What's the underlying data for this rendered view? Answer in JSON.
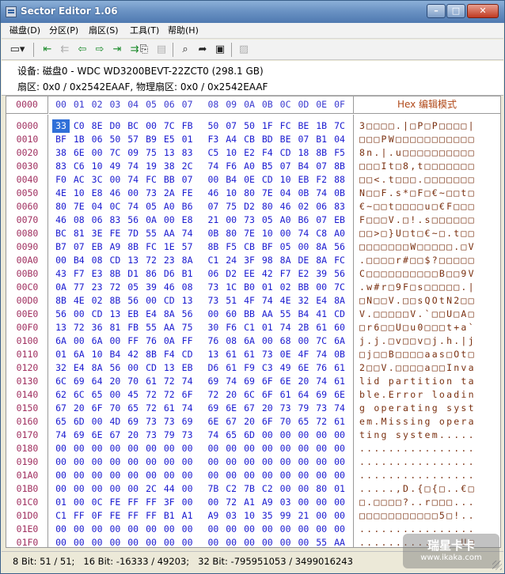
{
  "window": {
    "title": "Sector Editor 1.06"
  },
  "menu": [
    {
      "label": "磁盘(D)"
    },
    {
      "label": "分区(P)"
    },
    {
      "label": "扇区(S)"
    },
    {
      "label": "工具(T)"
    },
    {
      "label": "帮助(H)"
    }
  ],
  "toolbar_icons": [
    "disk-icon",
    "first-sector-icon",
    "prev-partition-icon",
    "prev-sector-icon",
    "next-sector-icon",
    "next-partition-icon",
    "last-sector-icon",
    "copy-icon",
    "paste-icon",
    "find-icon",
    "goto-icon",
    "export-icon",
    "save-icon"
  ],
  "info": {
    "device": "设备: 磁盘0 - WDC WD3200BEVT-22ZCT0 (298.1 GB)",
    "sector": "扇区: 0x0 / 0x2542EAAF, 物理扇区: 0x0 / 0x2542EAAF"
  },
  "header": {
    "offset": "0000",
    "columns": [
      "00",
      "01",
      "02",
      "03",
      "04",
      "05",
      "06",
      "07",
      "08",
      "09",
      "0A",
      "0B",
      "0C",
      "0D",
      "0E",
      "0F"
    ],
    "ascii_title": "Hex 编辑模式"
  },
  "rows": [
    {
      "offset": "0000",
      "bytes": [
        "33",
        "C0",
        "8E",
        "D0",
        "BC",
        "00",
        "7C",
        "FB",
        "50",
        "07",
        "50",
        "1F",
        "FC",
        "BE",
        "1B",
        "7C"
      ],
      "ascii": "3□□□□.|□P□P□□□□|"
    },
    {
      "offset": "0010",
      "bytes": [
        "BF",
        "1B",
        "06",
        "50",
        "57",
        "B9",
        "E5",
        "01",
        "F3",
        "A4",
        "CB",
        "BD",
        "BE",
        "07",
        "B1",
        "04"
      ],
      "ascii": "□□□PW□□□□□□□□□□□"
    },
    {
      "offset": "0020",
      "bytes": [
        "38",
        "6E",
        "00",
        "7C",
        "09",
        "75",
        "13",
        "83",
        "C5",
        "10",
        "E2",
        "F4",
        "CD",
        "18",
        "8B",
        "F5"
      ],
      "ascii": "8n.|.u□□□□□□□□□□"
    },
    {
      "offset": "0030",
      "bytes": [
        "83",
        "C6",
        "10",
        "49",
        "74",
        "19",
        "38",
        "2C",
        "74",
        "F6",
        "A0",
        "B5",
        "07",
        "B4",
        "07",
        "8B"
      ],
      "ascii": "□□□It□8,t□□□□□□□"
    },
    {
      "offset": "0040",
      "bytes": [
        "F0",
        "AC",
        "3C",
        "00",
        "74",
        "FC",
        "BB",
        "07",
        "00",
        "B4",
        "0E",
        "CD",
        "10",
        "EB",
        "F2",
        "88"
      ],
      "ascii": "□□<.t□□□.□□□□□□□"
    },
    {
      "offset": "0050",
      "bytes": [
        "4E",
        "10",
        "E8",
        "46",
        "00",
        "73",
        "2A",
        "FE",
        "46",
        "10",
        "80",
        "7E",
        "04",
        "0B",
        "74",
        "0B"
      ],
      "ascii": "N□□F.s*□F□€~□□t□"
    },
    {
      "offset": "0060",
      "bytes": [
        "80",
        "7E",
        "04",
        "0C",
        "74",
        "05",
        "A0",
        "B6",
        "07",
        "75",
        "D2",
        "80",
        "46",
        "02",
        "06",
        "83"
      ],
      "ascii": "€~□□t□□□□u□€F□□□"
    },
    {
      "offset": "0070",
      "bytes": [
        "46",
        "08",
        "06",
        "83",
        "56",
        "0A",
        "00",
        "E8",
        "21",
        "00",
        "73",
        "05",
        "A0",
        "B6",
        "07",
        "EB"
      ],
      "ascii": "F□□□V.□!.s□□□□□□"
    },
    {
      "offset": "0080",
      "bytes": [
        "BC",
        "81",
        "3E",
        "FE",
        "7D",
        "55",
        "AA",
        "74",
        "0B",
        "80",
        "7E",
        "10",
        "00",
        "74",
        "C8",
        "A0"
      ],
      "ascii": "□□>□}U□t□€~□.t□□"
    },
    {
      "offset": "0090",
      "bytes": [
        "B7",
        "07",
        "EB",
        "A9",
        "8B",
        "FC",
        "1E",
        "57",
        "8B",
        "F5",
        "CB",
        "BF",
        "05",
        "00",
        "8A",
        "56"
      ],
      "ascii": "□□□□□□□W□□□□□.□V"
    },
    {
      "offset": "00A0",
      "bytes": [
        "00",
        "B4",
        "08",
        "CD",
        "13",
        "72",
        "23",
        "8A",
        "C1",
        "24",
        "3F",
        "98",
        "8A",
        "DE",
        "8A",
        "FC"
      ],
      "ascii": ".□□□□r#□□$?□□□□□"
    },
    {
      "offset": "00B0",
      "bytes": [
        "43",
        "F7",
        "E3",
        "8B",
        "D1",
        "86",
        "D6",
        "B1",
        "06",
        "D2",
        "EE",
        "42",
        "F7",
        "E2",
        "39",
        "56"
      ],
      "ascii": "C□□□□□□□□□□B□□9V"
    },
    {
      "offset": "00C0",
      "bytes": [
        "0A",
        "77",
        "23",
        "72",
        "05",
        "39",
        "46",
        "08",
        "73",
        "1C",
        "B0",
        "01",
        "02",
        "BB",
        "00",
        "7C"
      ],
      "ascii": ".w#r□9F□s□□□□□.|"
    },
    {
      "offset": "00D0",
      "bytes": [
        "8B",
        "4E",
        "02",
        "8B",
        "56",
        "00",
        "CD",
        "13",
        "73",
        "51",
        "4F",
        "74",
        "4E",
        "32",
        "E4",
        "8A"
      ],
      "ascii": "□N□□V.□□sQOtN2□□"
    },
    {
      "offset": "00E0",
      "bytes": [
        "56",
        "00",
        "CD",
        "13",
        "EB",
        "E4",
        "8A",
        "56",
        "00",
        "60",
        "BB",
        "AA",
        "55",
        "B4",
        "41",
        "CD"
      ],
      "ascii": "V.□□□□□V.`□□U□A□"
    },
    {
      "offset": "00F0",
      "bytes": [
        "13",
        "72",
        "36",
        "81",
        "FB",
        "55",
        "AA",
        "75",
        "30",
        "F6",
        "C1",
        "01",
        "74",
        "2B",
        "61",
        "60"
      ],
      "ascii": "□r6□□U□u0□□□t+a`"
    },
    {
      "offset": "0100",
      "bytes": [
        "6A",
        "00",
        "6A",
        "00",
        "FF",
        "76",
        "0A",
        "FF",
        "76",
        "08",
        "6A",
        "00",
        "68",
        "00",
        "7C",
        "6A"
      ],
      "ascii": "j.j.□v□□v□j.h.|j"
    },
    {
      "offset": "0110",
      "bytes": [
        "01",
        "6A",
        "10",
        "B4",
        "42",
        "8B",
        "F4",
        "CD",
        "13",
        "61",
        "61",
        "73",
        "0E",
        "4F",
        "74",
        "0B"
      ],
      "ascii": "□j□□B□□□□aas□Ot□"
    },
    {
      "offset": "0120",
      "bytes": [
        "32",
        "E4",
        "8A",
        "56",
        "00",
        "CD",
        "13",
        "EB",
        "D6",
        "61",
        "F9",
        "C3",
        "49",
        "6E",
        "76",
        "61"
      ],
      "ascii": "2□□V.□□□□a□□Inva"
    },
    {
      "offset": "0130",
      "bytes": [
        "6C",
        "69",
        "64",
        "20",
        "70",
        "61",
        "72",
        "74",
        "69",
        "74",
        "69",
        "6F",
        "6E",
        "20",
        "74",
        "61"
      ],
      "ascii": "lid partition ta"
    },
    {
      "offset": "0140",
      "bytes": [
        "62",
        "6C",
        "65",
        "00",
        "45",
        "72",
        "72",
        "6F",
        "72",
        "20",
        "6C",
        "6F",
        "61",
        "64",
        "69",
        "6E"
      ],
      "ascii": "ble.Error loadin"
    },
    {
      "offset": "0150",
      "bytes": [
        "67",
        "20",
        "6F",
        "70",
        "65",
        "72",
        "61",
        "74",
        "69",
        "6E",
        "67",
        "20",
        "73",
        "79",
        "73",
        "74"
      ],
      "ascii": "g operating syst"
    },
    {
      "offset": "0160",
      "bytes": [
        "65",
        "6D",
        "00",
        "4D",
        "69",
        "73",
        "73",
        "69",
        "6E",
        "67",
        "20",
        "6F",
        "70",
        "65",
        "72",
        "61"
      ],
      "ascii": "em.Missing opera"
    },
    {
      "offset": "0170",
      "bytes": [
        "74",
        "69",
        "6E",
        "67",
        "20",
        "73",
        "79",
        "73",
        "74",
        "65",
        "6D",
        "00",
        "00",
        "00",
        "00",
        "00"
      ],
      "ascii": "ting system....."
    },
    {
      "offset": "0180",
      "bytes": [
        "00",
        "00",
        "00",
        "00",
        "00",
        "00",
        "00",
        "00",
        "00",
        "00",
        "00",
        "00",
        "00",
        "00",
        "00",
        "00"
      ],
      "ascii": "................"
    },
    {
      "offset": "0190",
      "bytes": [
        "00",
        "00",
        "00",
        "00",
        "00",
        "00",
        "00",
        "00",
        "00",
        "00",
        "00",
        "00",
        "00",
        "00",
        "00",
        "00"
      ],
      "ascii": "................"
    },
    {
      "offset": "01A0",
      "bytes": [
        "00",
        "00",
        "00",
        "00",
        "00",
        "00",
        "00",
        "00",
        "00",
        "00",
        "00",
        "00",
        "00",
        "00",
        "00",
        "00"
      ],
      "ascii": "................"
    },
    {
      "offset": "01B0",
      "bytes": [
        "00",
        "00",
        "00",
        "00",
        "00",
        "2C",
        "44",
        "00",
        "7B",
        "C2",
        "7B",
        "C2",
        "00",
        "00",
        "80",
        "01"
      ],
      "ascii": ".....,D.{□{□..€□"
    },
    {
      "offset": "01C0",
      "bytes": [
        "01",
        "00",
        "0C",
        "FE",
        "FF",
        "FF",
        "3F",
        "00",
        "00",
        "72",
        "A1",
        "A9",
        "03",
        "00",
        "00",
        "00"
      ],
      "ascii": "□.□□□□?..r□□□..."
    },
    {
      "offset": "01D0",
      "bytes": [
        "C1",
        "FF",
        "0F",
        "FE",
        "FF",
        "FF",
        "B1",
        "A1",
        "A9",
        "03",
        "10",
        "35",
        "99",
        "21",
        "00",
        "00"
      ],
      "ascii": "□□□□□□□□□□□5□!.."
    },
    {
      "offset": "01E0",
      "bytes": [
        "00",
        "00",
        "00",
        "00",
        "00",
        "00",
        "00",
        "00",
        "00",
        "00",
        "00",
        "00",
        "00",
        "00",
        "00",
        "00"
      ],
      "ascii": "................"
    },
    {
      "offset": "01F0",
      "bytes": [
        "00",
        "00",
        "00",
        "00",
        "00",
        "00",
        "00",
        "00",
        "00",
        "00",
        "00",
        "00",
        "00",
        "00",
        "55",
        "AA"
      ],
      "ascii": "..............U□"
    }
  ],
  "status": "8 Bit: 51 / 51;   16 Bit: -16333 / 49203;   32 Bit: -795951053 / 3499016243",
  "watermark": {
    "line1": "瑞星卡卡",
    "line2": "www.ikaka.com"
  }
}
